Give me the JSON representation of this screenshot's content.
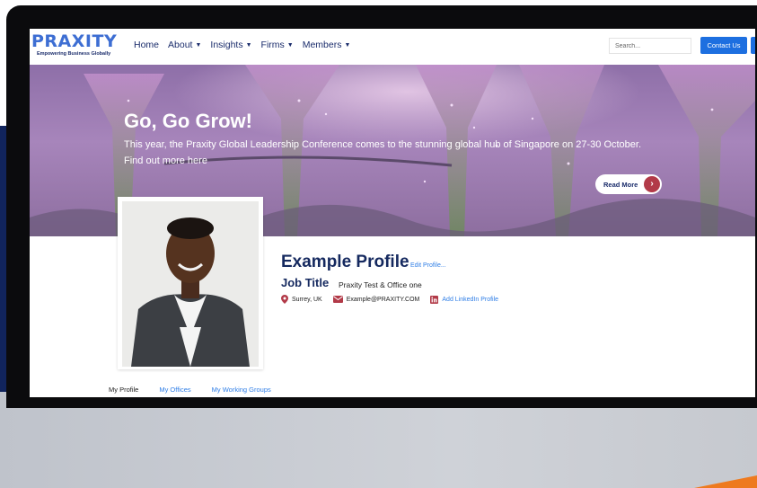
{
  "logo": {
    "name": "PRAXITY",
    "tagline": "Empowering Business Globally"
  },
  "nav": {
    "items": [
      {
        "label": "Home",
        "has_caret": false
      },
      {
        "label": "About",
        "has_caret": true
      },
      {
        "label": "Insights",
        "has_caret": true
      },
      {
        "label": "Firms",
        "has_caret": true
      },
      {
        "label": "Members",
        "has_caret": true
      }
    ],
    "caret_glyph": "▼",
    "search_placeholder": "Search...",
    "contact_label": "Contact Us"
  },
  "hero": {
    "title": "Go, Go Grow!",
    "text": "This year, the Praxity Global Leadership Conference comes to the stunning global hub of Singapore on 27-30 October. Find out more here",
    "cta_label": "Read More",
    "cta_arrow": "›"
  },
  "profile": {
    "name": "Example Profile",
    "edit_label": "Edit Profile...",
    "job_title": "Job Title",
    "office": "Praxity Test & Office one",
    "location": "Surrey, UK",
    "email": "Example@PRAXITY.COM",
    "linkedin_label": "Add LinkedIn Profile"
  },
  "tabs": [
    {
      "label": "My Profile",
      "active": true
    },
    {
      "label": "My Offices",
      "active": false
    },
    {
      "label": "My Working Groups",
      "active": false
    }
  ],
  "colors": {
    "brand_navy": "#15295f",
    "brand_blue": "#1d6fe0",
    "accent_red": "#b23a48",
    "link_blue": "#2f7ee6"
  },
  "icons": {
    "location": "map-pin-icon",
    "email": "envelope-icon",
    "linkedin": "linkedin-icon",
    "cta": "chevron-right-icon"
  }
}
